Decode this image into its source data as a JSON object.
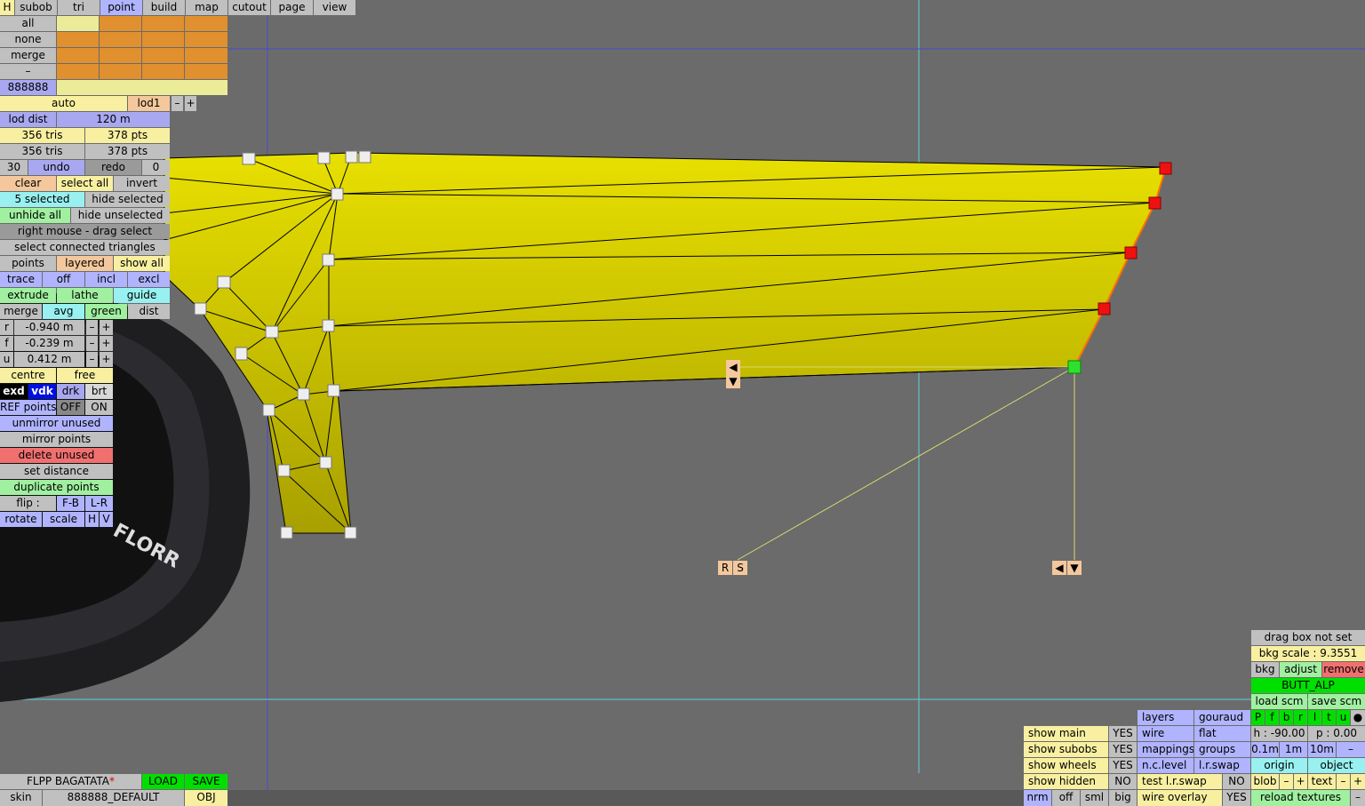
{
  "menu": {
    "h": "H",
    "tabs": [
      "subob",
      "tri",
      "point",
      "build",
      "map",
      "cutout",
      "page",
      "view"
    ]
  },
  "rows": {
    "all": "all",
    "none": "none",
    "merge": "merge",
    "dash": "–",
    "code": "888888"
  },
  "lod": {
    "auto": "auto",
    "lod1": "lod1",
    "minus": "–",
    "plus": "+",
    "dist_label": "lod dist",
    "dist_val": "120 m"
  },
  "stats": {
    "tris1": "356 tris",
    "pts1": "378 pts",
    "tris2": "356 tris",
    "pts2": "378 pts"
  },
  "undo": {
    "n1": "30",
    "undo": "undo",
    "redo": "redo",
    "n2": "0"
  },
  "sel": {
    "clear": "clear",
    "select_all": "select all",
    "invert": "invert",
    "selected": "5 selected",
    "hide_selected": "hide selected",
    "unhide_all": "unhide all",
    "hide_unselected": "hide unselected",
    "right_mouse": "right mouse - drag select",
    "connected": "select connected triangles"
  },
  "view": {
    "points": "points",
    "layered": "layered",
    "show_all": "show all",
    "trace": "trace",
    "off": "off",
    "incl": "incl",
    "excl": "excl",
    "extrude": "extrude",
    "lathe": "lathe",
    "guide": "guide",
    "merge": "merge",
    "avg": "avg",
    "green": "green",
    "dist": "dist"
  },
  "coords": {
    "r": "r",
    "r_val": "-0.940 m",
    "f": "f",
    "f_val": "-0.239 m",
    "u": "u",
    "u_val": "0.412 m",
    "minus": "–",
    "plus": "+"
  },
  "pts": {
    "centre": "centre",
    "free": "free",
    "exd": "exd",
    "vdk": "vdk",
    "drk": "drk",
    "brt": "brt",
    "ref": "REF points",
    "off": "OFF",
    "on": "ON",
    "unmirror": "unmirror unused",
    "mirror": "mirror points",
    "delete": "delete unused",
    "set_dist": "set distance",
    "duplicate": "duplicate points",
    "flip": "flip :",
    "fb": "F-B",
    "lr": "L-R",
    "rotate": "rotate",
    "scale": "scale",
    "h": "H",
    "v": "V"
  },
  "bottom_left": {
    "name": "FLPP BAGATATA",
    "star": "*",
    "load": "LOAD",
    "save": "SAVE",
    "skin": "skin",
    "skin_val": "888888_DEFAULT",
    "obj": "OBJ"
  },
  "gizmo": {
    "left": "◀",
    "down": "▼",
    "r": "R",
    "s": "S"
  },
  "shows": [
    {
      "label": "show main",
      "val": "YES"
    },
    {
      "label": "show subobs",
      "val": "YES"
    },
    {
      "label": "show wheels",
      "val": "YES"
    },
    {
      "label": "show hidden",
      "val": "NO"
    }
  ],
  "render": {
    "layers": "layers",
    "gouraud": "gouraud",
    "wire": "wire",
    "flat": "flat",
    "mappings": "mappings",
    "groups": "groups",
    "nclevel": "n.c.level",
    "lrswap": "l.r.swap",
    "test_lrswap": "test l.r.swap",
    "no": "NO",
    "wire_overlay": "wire overlay",
    "yes": "YES",
    "nrm": "nrm",
    "off": "off",
    "sml": "sml",
    "big": "big"
  },
  "right": {
    "drag_box": "drag box not set",
    "bkg_scale": "bkg scale : 9.3551",
    "bkg": "bkg",
    "adjust": "adjust",
    "remove": "remove",
    "butt": "BUTT_ALP",
    "load_scm": "load scm",
    "save_scm": "save scm",
    "letters": [
      "P",
      "f",
      "b",
      "r",
      "l",
      "t",
      "u",
      "●"
    ],
    "h": "h : -90.00",
    "p": "p : 0.00",
    "s1": "0.1m",
    "s2": "1m",
    "s3": "10m",
    "minus": "–",
    "origin": "origin",
    "object": "object",
    "blob": "blob",
    "text": "text",
    "plus": "+",
    "reload": "reload textures"
  },
  "colors": {
    "mesh": "#c8c000",
    "panel_yellow": "#f8f0a0",
    "panel_orange": "#e0902e",
    "accent_green": "#00e000",
    "selected_red": "#ee1111"
  }
}
